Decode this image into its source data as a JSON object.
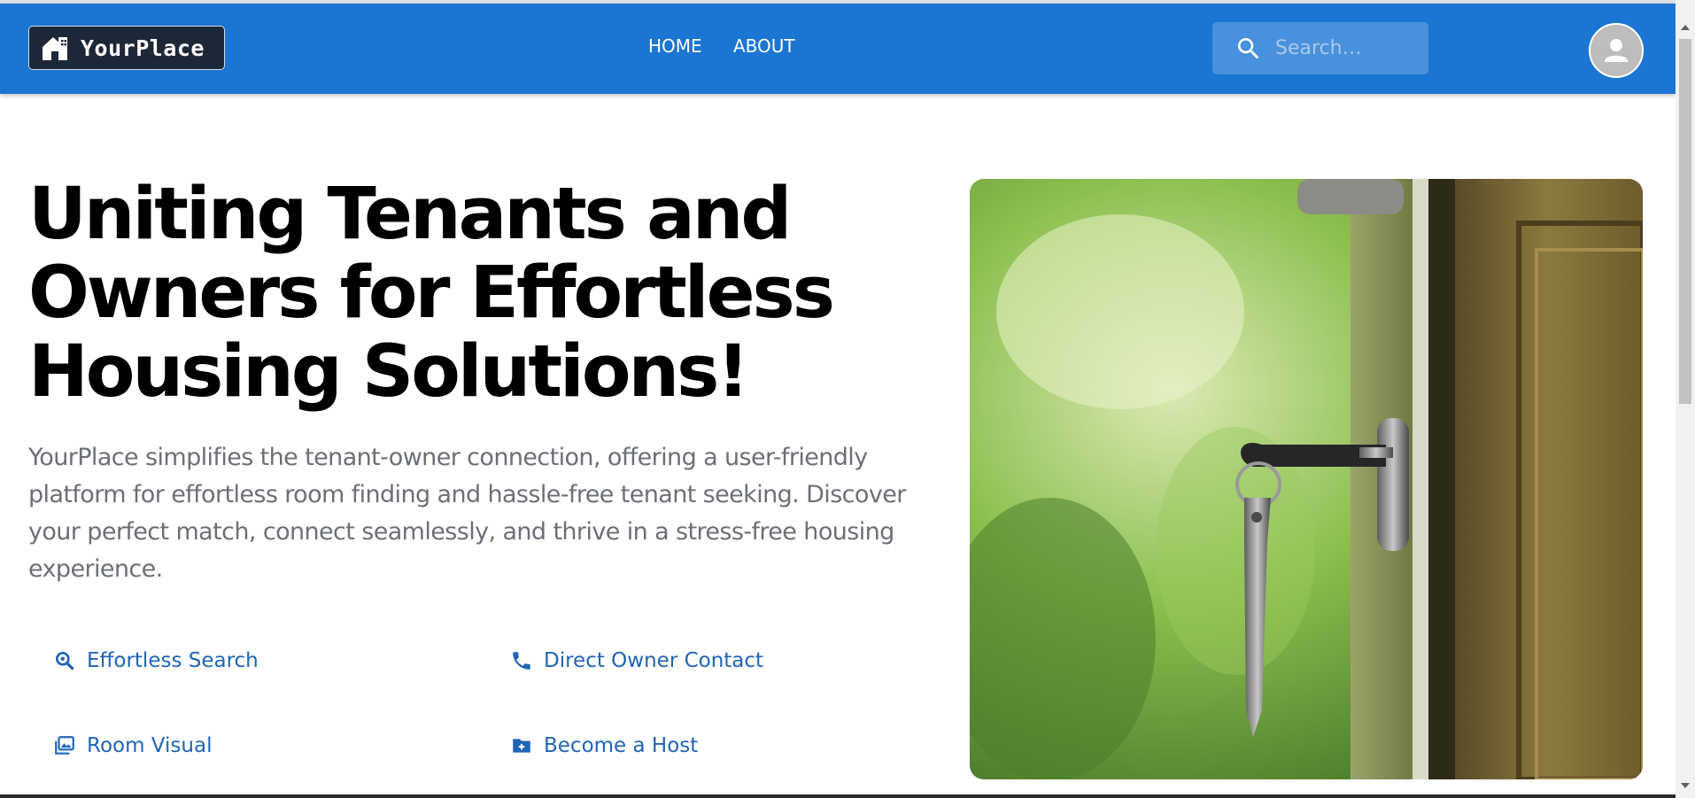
{
  "header": {
    "logo_text": "YourPlace",
    "nav": {
      "home": "HOME",
      "about": "ABOUT"
    },
    "search": {
      "placeholder": "Search…",
      "value": "",
      "icon": "search-icon"
    },
    "avatar_icon": "account-circle-icon"
  },
  "hero": {
    "title": "Uniting Tenants and Owners for Effortless Housing Solutions!",
    "description": "YourPlace simplifies the tenant-owner connection, offering a user-friendly platform for effortless room finding and hassle-free tenant seeking. Discover your perfect match, connect seamlessly, and thrive in a stress-free housing experience.",
    "image_icon": "door-with-keys-photo"
  },
  "features": [
    {
      "label": "Effortless Search",
      "icon": "magnify-icon"
    },
    {
      "label": "Direct Owner Contact",
      "icon": "phone-icon"
    },
    {
      "label": "Room Visual",
      "icon": "image-gallery-icon"
    },
    {
      "label": "Become a Host",
      "icon": "folder-plus-icon"
    }
  ],
  "colors": {
    "primary": "#1a76d2",
    "feature_text": "#1f64b5",
    "description_text": "#6b6f76",
    "logo_bg": "#1c2838"
  }
}
